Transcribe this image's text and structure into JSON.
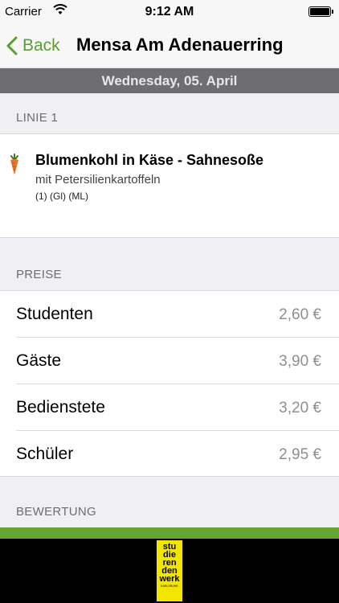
{
  "status_bar": {
    "carrier": "Carrier",
    "time": "9:12 AM"
  },
  "nav": {
    "back_label": "Back",
    "title": "Mensa Am Adenauerring",
    "accent_color": "#5a9e2f"
  },
  "date": "Wednesday, 05. April",
  "line_section": {
    "header": "LINIE 1",
    "meal": {
      "icon": "carrot-icon",
      "title": "Blumenkohl in Käse - Sahnesoße",
      "subtitle": "mit Petersilienkartoffeln",
      "tags": "(1) (Gl) (ML)"
    }
  },
  "prices_section": {
    "header": "PREISE",
    "rows": [
      {
        "label": "Studenten",
        "price": "2,60 €"
      },
      {
        "label": "Gäste",
        "price": "3,90 €"
      },
      {
        "label": "Bedienstete",
        "price": "3,20 €"
      },
      {
        "label": "Schüler",
        "price": "2,95 €"
      }
    ]
  },
  "rating_section": {
    "header": "BEWERTUNG"
  },
  "footer": {
    "logo_words": [
      "stu",
      "die",
      "ren",
      "den",
      "werk"
    ],
    "logo_small": "KARLSRUHE",
    "logo_color": "#f2e500",
    "bar_color": "#66a532"
  }
}
